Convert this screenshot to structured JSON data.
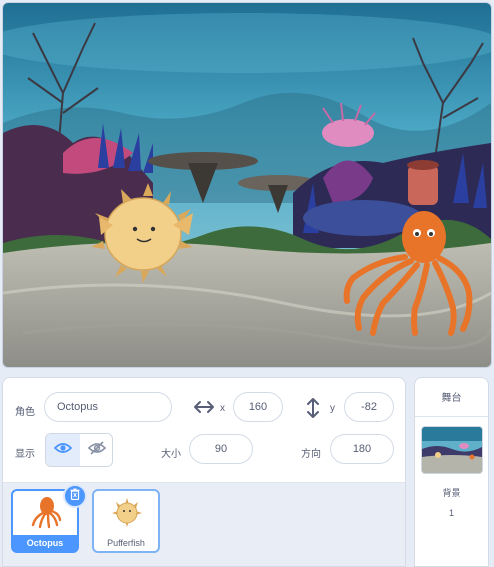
{
  "sprite_info": {
    "sprite_label": "角色",
    "sprite_name": "Octopus",
    "x_label": "x",
    "x_value": "160",
    "y_label": "y",
    "y_value": "-82",
    "show_label": "显示",
    "size_label": "大小",
    "size_value": "90",
    "direction_label": "方向",
    "direction_value": "180"
  },
  "sprites": [
    {
      "name": "Octopus",
      "selected": true
    },
    {
      "name": "Pufferfish",
      "selected": false
    }
  ],
  "stage_panel": {
    "title": "舞台",
    "backdrop_label": "背景",
    "backdrop_count": "1"
  },
  "icons": {
    "x_axis": "horizontal-arrows-icon",
    "y_axis": "vertical-arrows-icon",
    "show": "eye-icon",
    "hide": "eye-slash-icon",
    "delete": "trash-icon"
  },
  "colors": {
    "accent": "#4c97ff",
    "text": "#575e75",
    "octopus": "#e8742a",
    "pufferfish": "#f3d08a"
  }
}
